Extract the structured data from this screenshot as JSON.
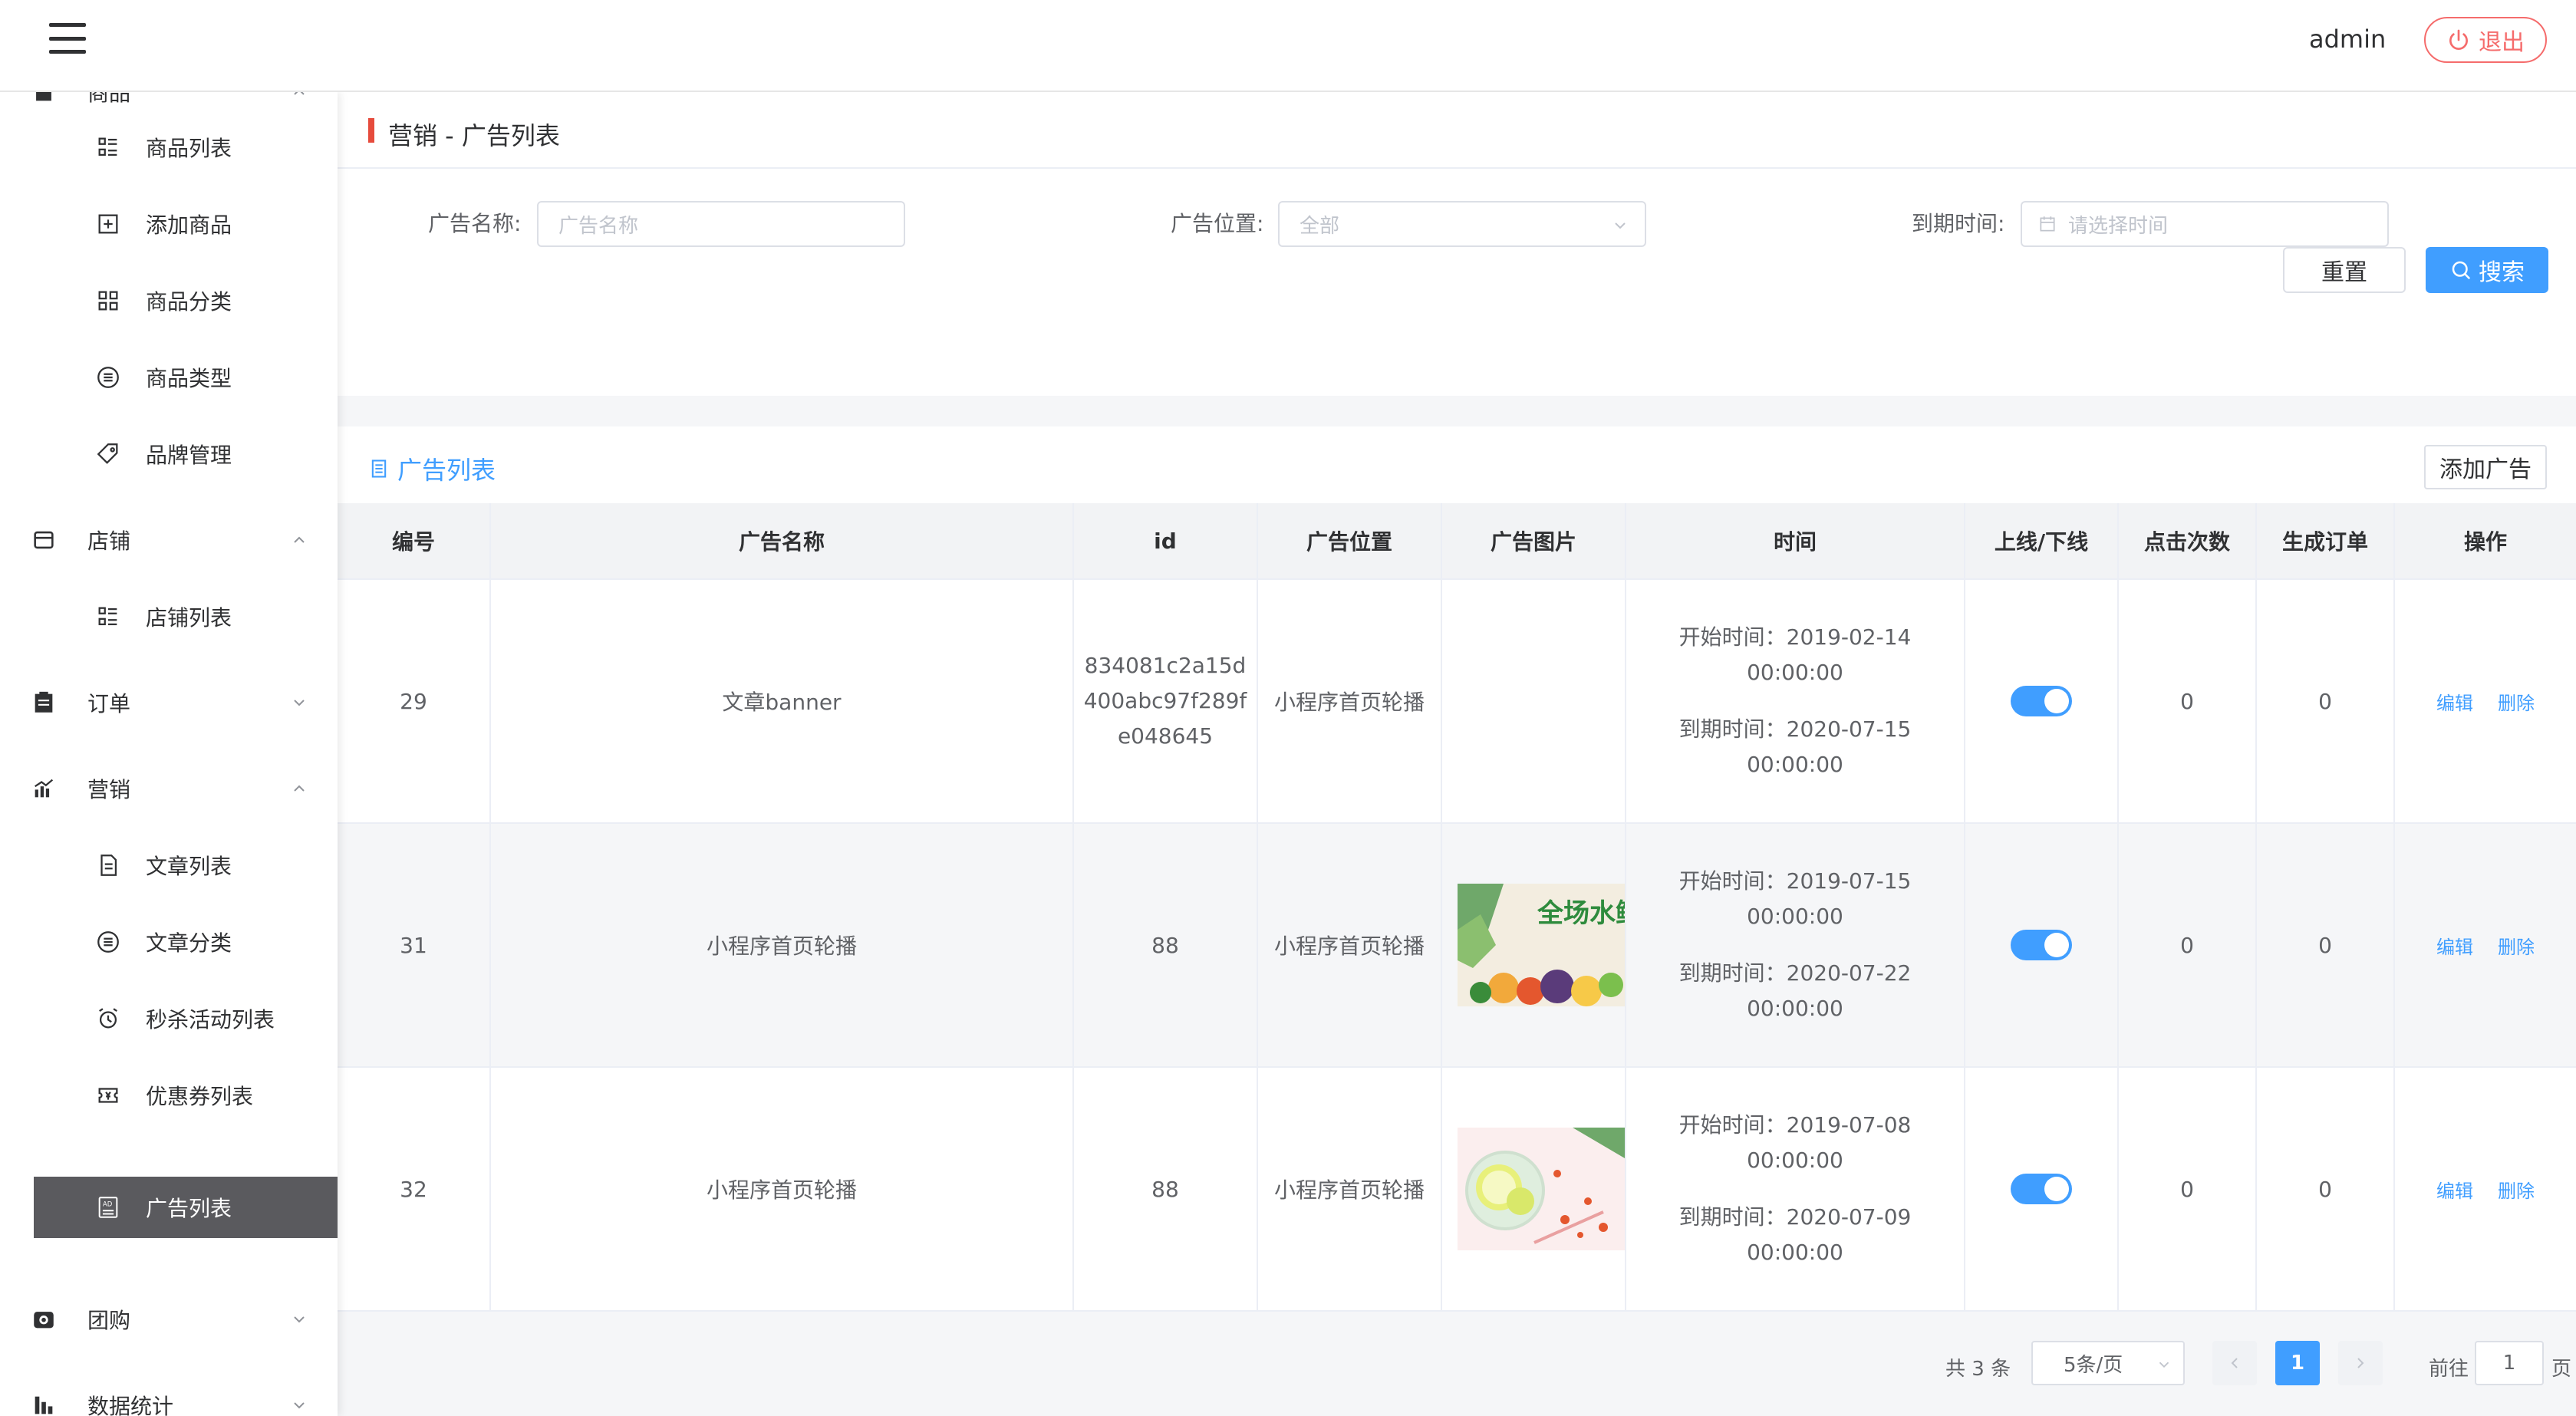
{
  "header": {
    "user": "admin",
    "logout_label": "退出"
  },
  "sidebar": {
    "groups": [
      {
        "label": "商品",
        "items": [
          "商品列表",
          "添加商品",
          "商品分类",
          "商品类型",
          "品牌管理"
        ]
      },
      {
        "label": "店铺",
        "items": [
          "店铺列表"
        ]
      },
      {
        "label": "订单"
      },
      {
        "label": "营销",
        "items": [
          "文章列表",
          "文章分类",
          "秒杀活动列表",
          "优惠券列表",
          "广告列表"
        ]
      },
      {
        "label": "团购"
      },
      {
        "label": "数据统计"
      }
    ],
    "active_item": "广告列表"
  },
  "breadcrumb": "营销 - 广告列表",
  "filters": {
    "name_label": "广告名称:",
    "name_placeholder": "广告名称",
    "position_label": "广告位置:",
    "position_value": "全部",
    "expire_label": "到期时间:",
    "expire_placeholder": "请选择时间",
    "reset_label": "重置",
    "search_label": "搜索"
  },
  "list": {
    "title": "广告列表",
    "add_label": "添加广告",
    "columns": [
      "编号",
      "广告名称",
      "id",
      "广告位置",
      "广告图片",
      "时间",
      "上线/下线",
      "点击次数",
      "生成订单",
      "操作"
    ],
    "rows": [
      {
        "no": "29",
        "name": "文章banner",
        "id": "834081c2a15d400abc97f289fe048645",
        "position": "小程序首页轮播",
        "start": "开始时间：2019-02-14 00:00:00",
        "end": "到期时间：2020-07-15 00:00:00",
        "clicks": "0",
        "orders": "0",
        "online": true
      },
      {
        "no": "31",
        "name": "小程序首页轮播",
        "id": "88",
        "position": "小程序首页轮播",
        "start": "开始时间：2019-07-15 00:00:00",
        "end": "到期时间：2020-07-22 00:00:00",
        "clicks": "0",
        "orders": "0",
        "online": true,
        "image_text": "全场水鲜到先"
      },
      {
        "no": "32",
        "name": "小程序首页轮播",
        "id": "88",
        "position": "小程序首页轮播",
        "start": "开始时间：2019-07-08 00:00:00",
        "end": "到期时间：2020-07-09 00:00:00",
        "clicks": "0",
        "orders": "0",
        "online": true
      }
    ],
    "edit_label": "编辑",
    "delete_label": "删除"
  },
  "pager": {
    "total": "共 3 条",
    "page_size": "5条/页",
    "current": "1",
    "goto_label": "前往",
    "goto_value": "1",
    "page_suffix": "页"
  },
  "colors": {
    "accent": "#409eff",
    "danger": "#f56c6c",
    "breadcrumb_bar": "#e64b3c",
    "active_bg": "#5a5a5e"
  }
}
